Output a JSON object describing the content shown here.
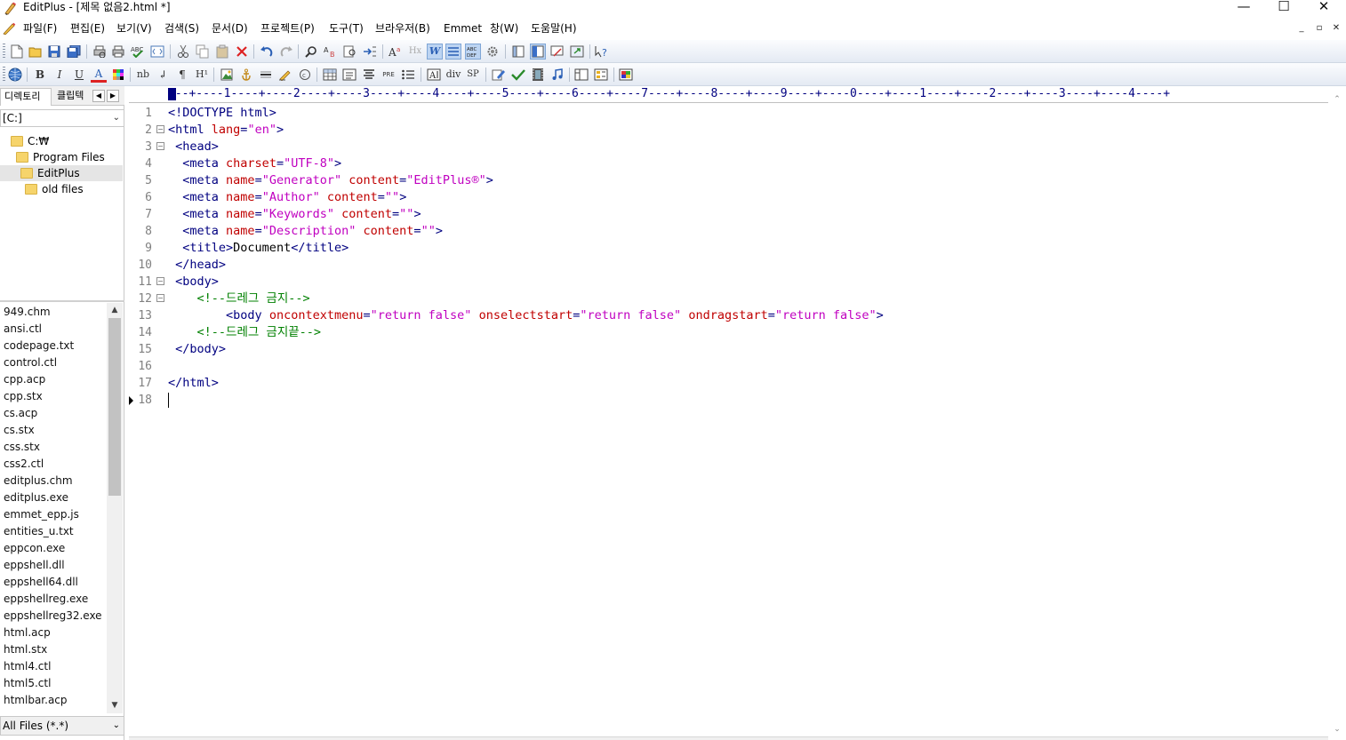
{
  "window": {
    "title": "EditPlus - [제목 없음2.html *]",
    "controls": [
      "—",
      "☐",
      "✕"
    ]
  },
  "menu": [
    "파일(F)",
    "편집(E)",
    "보기(V)",
    "검색(S)",
    "문서(D)",
    "프로젝트(P)",
    "도구(T)",
    "브라우저(B)",
    "Emmet",
    "창(W)",
    "도움말(H)"
  ],
  "mdi_controls": [
    "_",
    "▫",
    "✕"
  ],
  "toolbar2_labels": {
    "bold": "B",
    "italic": "I",
    "underline": "U",
    "font": "A",
    "nb": "nb",
    "br": "↲",
    "para": "¶",
    "heading": "H¹",
    "pre": "PRE",
    "div": "div",
    "sp": "SP",
    "hx": "Hx"
  },
  "sidebar": {
    "tabs": [
      "디렉토리",
      "클립텍"
    ],
    "drive": "[C:]",
    "tree": [
      "C:₩",
      "Program Files",
      "EditPlus",
      "old files"
    ],
    "selected_tree_item": "EditPlus",
    "files": [
      "949.chm",
      "ansi.ctl",
      "codepage.txt",
      "control.ctl",
      "cpp.acp",
      "cpp.stx",
      "cs.acp",
      "cs.stx",
      "css.stx",
      "css2.ctl",
      "editplus.chm",
      "editplus.exe",
      "emmet_epp.js",
      "entities_u.txt",
      "eppcon.exe",
      "eppshell.dll",
      "eppshell64.dll",
      "eppshellreg.exe",
      "eppshellreg32.exe",
      "html.acp",
      "html.stx",
      "html4.ctl",
      "html5.ctl",
      "htmlbar.acp"
    ],
    "filter": "All Files (*.*)"
  },
  "ruler": "---+----1----+----2----+----3----+----4----+----5----+----6----+----7----+----8----+----9----+----0----+----1----+----2----+----3----+----4----+",
  "editor": {
    "line_numbers": [
      "1",
      "2",
      "3",
      "4",
      "5",
      "6",
      "7",
      "8",
      "9",
      "10",
      "11",
      "12",
      "13",
      "14",
      "15",
      "16",
      "17",
      "18"
    ],
    "current_line": "18"
  },
  "colors": {
    "tag": "#000080",
    "attribute": "#c00000",
    "string": "#c000c0",
    "comment": "#008000",
    "line_number": "#808080"
  }
}
